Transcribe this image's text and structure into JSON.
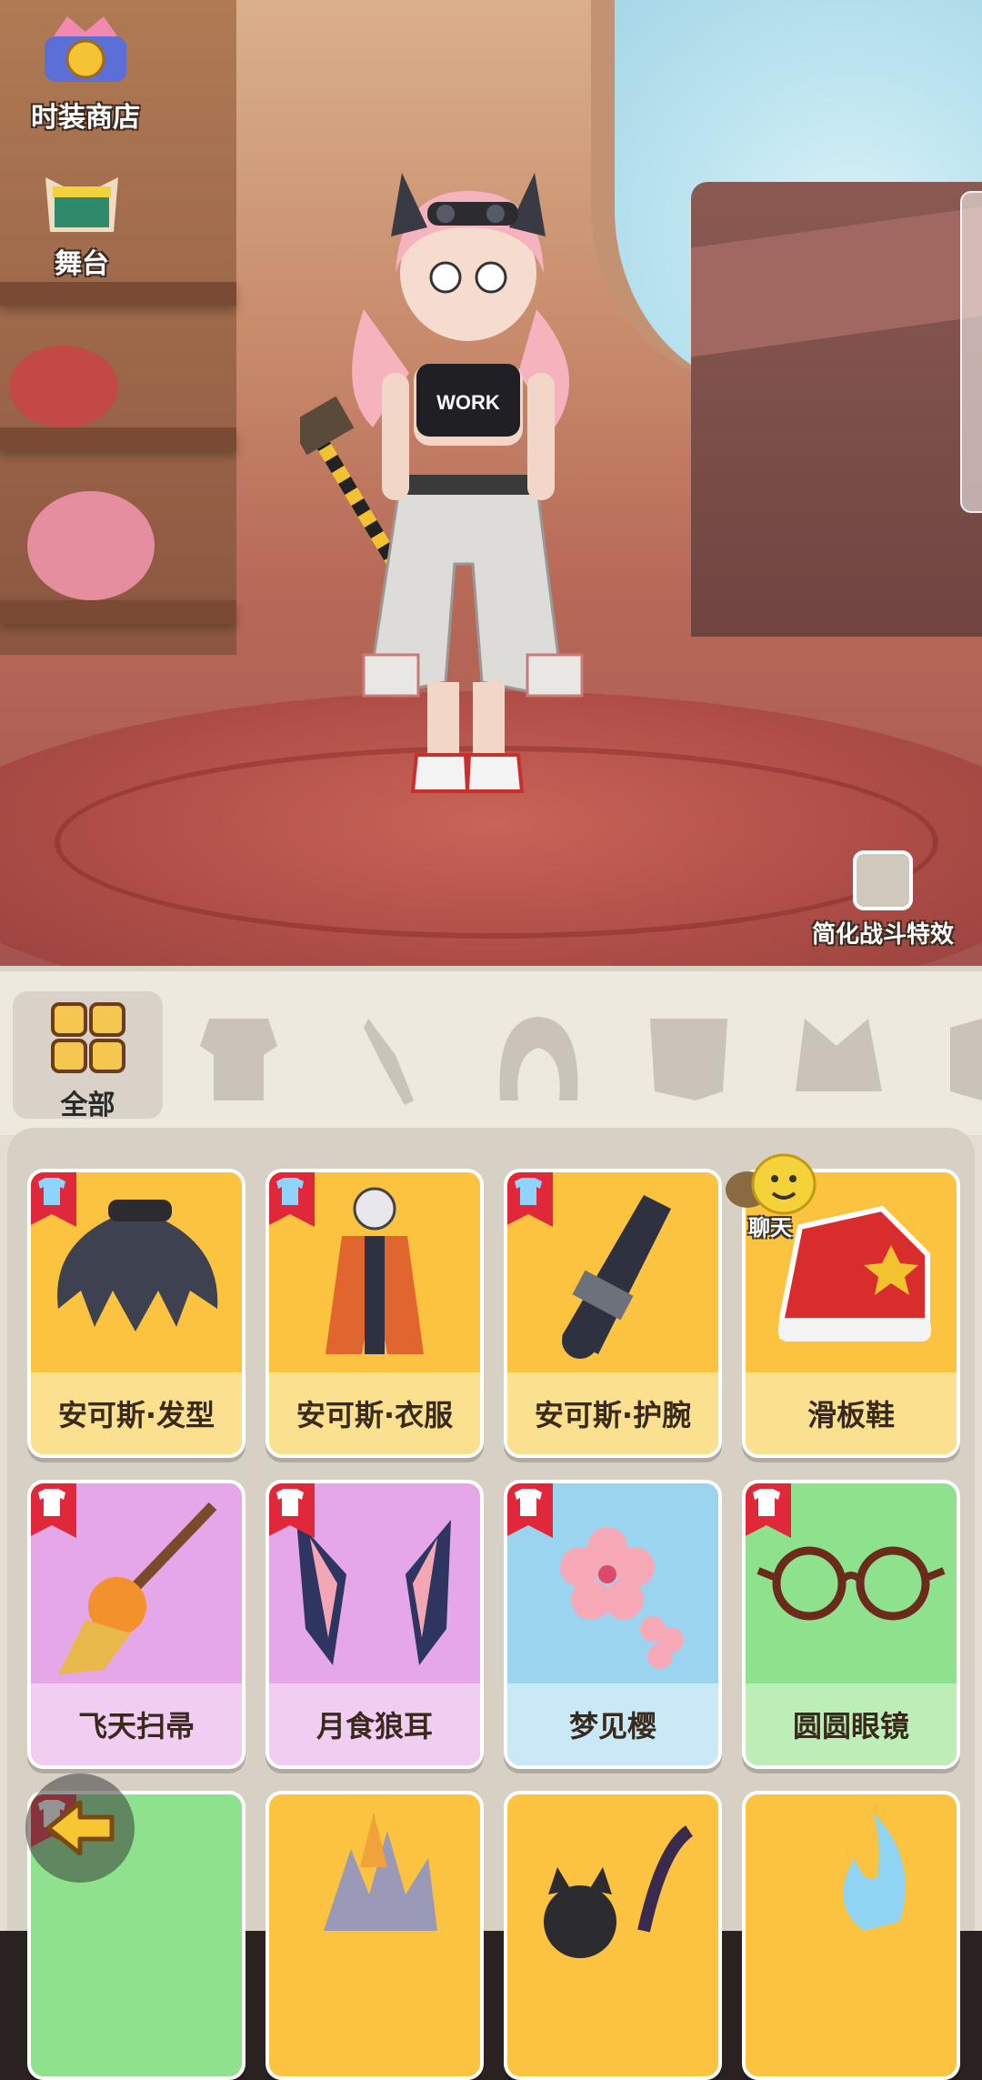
{
  "scene": {
    "fashion_shop_label": "时装商店",
    "stage_label": "舞台",
    "simplify_effects_label": "简化战斗特效",
    "shirt_text": "WORK"
  },
  "categories": [
    {
      "id": "all",
      "label": "全部",
      "icon": "grid-icon",
      "active": true
    },
    {
      "id": "outfit",
      "icon": "outfit-icon"
    },
    {
      "id": "weapon",
      "icon": "dagger-icon"
    },
    {
      "id": "hair",
      "icon": "hair-icon"
    },
    {
      "id": "face",
      "icon": "face-mask-icon"
    },
    {
      "id": "ears",
      "icon": "ears-icon"
    }
  ],
  "items": [
    {
      "name": "安可斯·发型",
      "color": "gold",
      "icon": "hair-item-icon",
      "flag": "rainbow-shirt"
    },
    {
      "name": "安可斯·衣服",
      "color": "gold",
      "icon": "outfit-item-icon",
      "flag": "rainbow-shirt"
    },
    {
      "name": "安可斯·护腕",
      "color": "gold",
      "icon": "bracer-item-icon",
      "flag": "rainbow-shirt"
    },
    {
      "name": "滑板鞋",
      "color": "gold",
      "icon": "sneaker-item-icon",
      "flag": "none"
    },
    {
      "name": "飞天扫帚",
      "color": "purple",
      "icon": "broom-item-icon",
      "flag": "white-shirt"
    },
    {
      "name": "月食狼耳",
      "color": "purple",
      "icon": "wolf-ears-item-icon",
      "flag": "white-shirt"
    },
    {
      "name": "梦见樱",
      "color": "blue",
      "icon": "sakura-item-icon",
      "flag": "white-shirt"
    },
    {
      "name": "圆圆眼镜",
      "color": "green",
      "icon": "glasses-item-icon",
      "flag": "white-shirt"
    },
    {
      "name": "",
      "color": "green",
      "icon": "partial-item-icon",
      "flag": "white-shirt"
    },
    {
      "name": "",
      "color": "gold",
      "icon": "partial-item-icon",
      "flag": "none"
    },
    {
      "name": "",
      "color": "gold",
      "icon": "cat-item-icon",
      "flag": "none"
    },
    {
      "name": "",
      "color": "gold",
      "icon": "flame-item-icon",
      "flag": "none"
    }
  ],
  "chat": {
    "label": "聊天"
  },
  "colors": {
    "gold": "#fbc33f",
    "purple": "#e6a7e8",
    "blue": "#9bd4ee",
    "green": "#8ee28e",
    "flag_red": "#e0283a"
  }
}
